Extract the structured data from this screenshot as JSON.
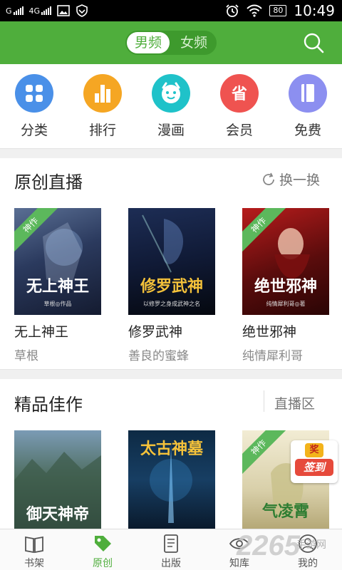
{
  "status_bar": {
    "signal_1": "G",
    "signal_2": "4G",
    "battery": "80",
    "time": "10:49"
  },
  "header": {
    "tabs": [
      {
        "label": "男频",
        "active": true
      },
      {
        "label": "女频",
        "active": false
      }
    ],
    "icons": {
      "search": "search-icon"
    }
  },
  "quick_nav": [
    {
      "label": "分类",
      "icon": "category-grid-icon",
      "color": "#4a90e8"
    },
    {
      "label": "排行",
      "icon": "ranking-bars-icon",
      "color": "#f5a623"
    },
    {
      "label": "漫画",
      "icon": "comic-face-icon",
      "color": "#1fc2c9"
    },
    {
      "label": "会员",
      "icon": "member-save-icon",
      "color": "#ef5350"
    },
    {
      "label": "免费",
      "icon": "free-book-icon",
      "color": "#8c8ff0"
    }
  ],
  "section_original": {
    "title": "原创直播",
    "action": "换一换",
    "books": [
      {
        "name": "无上神王",
        "author": "草根",
        "badge": "神作",
        "cover_title": "无上神王",
        "cover_sub": "草根◎作品"
      },
      {
        "name": "修罗武神",
        "author": "善良的蜜蜂",
        "badge": "",
        "cover_title": "修罗武神",
        "cover_sub": "以修罗之身成武神之名"
      },
      {
        "name": "绝世邪神",
        "author": "纯情犀利哥",
        "badge": "神作",
        "cover_title": "绝世邪神",
        "cover_sub": "纯情犀利哥◎著"
      }
    ]
  },
  "section_quality": {
    "title": "精品佳作",
    "action": "直播区",
    "books": [
      {
        "badge": "",
        "cover_title": "御天神帝",
        "cover_sub": ""
      },
      {
        "badge": "",
        "cover_title": "太古神墓",
        "cover_sub": ""
      },
      {
        "badge": "神作",
        "cover_title": "气凌霄",
        "cover_sub": ""
      }
    ]
  },
  "checkin": {
    "top": "奖",
    "label": "签到"
  },
  "bottom_nav": [
    {
      "label": "书架",
      "icon": "bookshelf-icon",
      "active": false
    },
    {
      "label": "原创",
      "icon": "original-tag-icon",
      "active": true
    },
    {
      "label": "出版",
      "icon": "publish-book-icon",
      "active": false
    },
    {
      "label": "知库",
      "icon": "knowledge-eye-icon",
      "active": false
    },
    {
      "label": "我的",
      "icon": "profile-icon",
      "active": false
    }
  ],
  "watermark": {
    "number": "2265",
    "text": "手游网"
  },
  "colors": {
    "brand_green": "#4fae3c",
    "ribbon_green": "#5cb85c"
  }
}
